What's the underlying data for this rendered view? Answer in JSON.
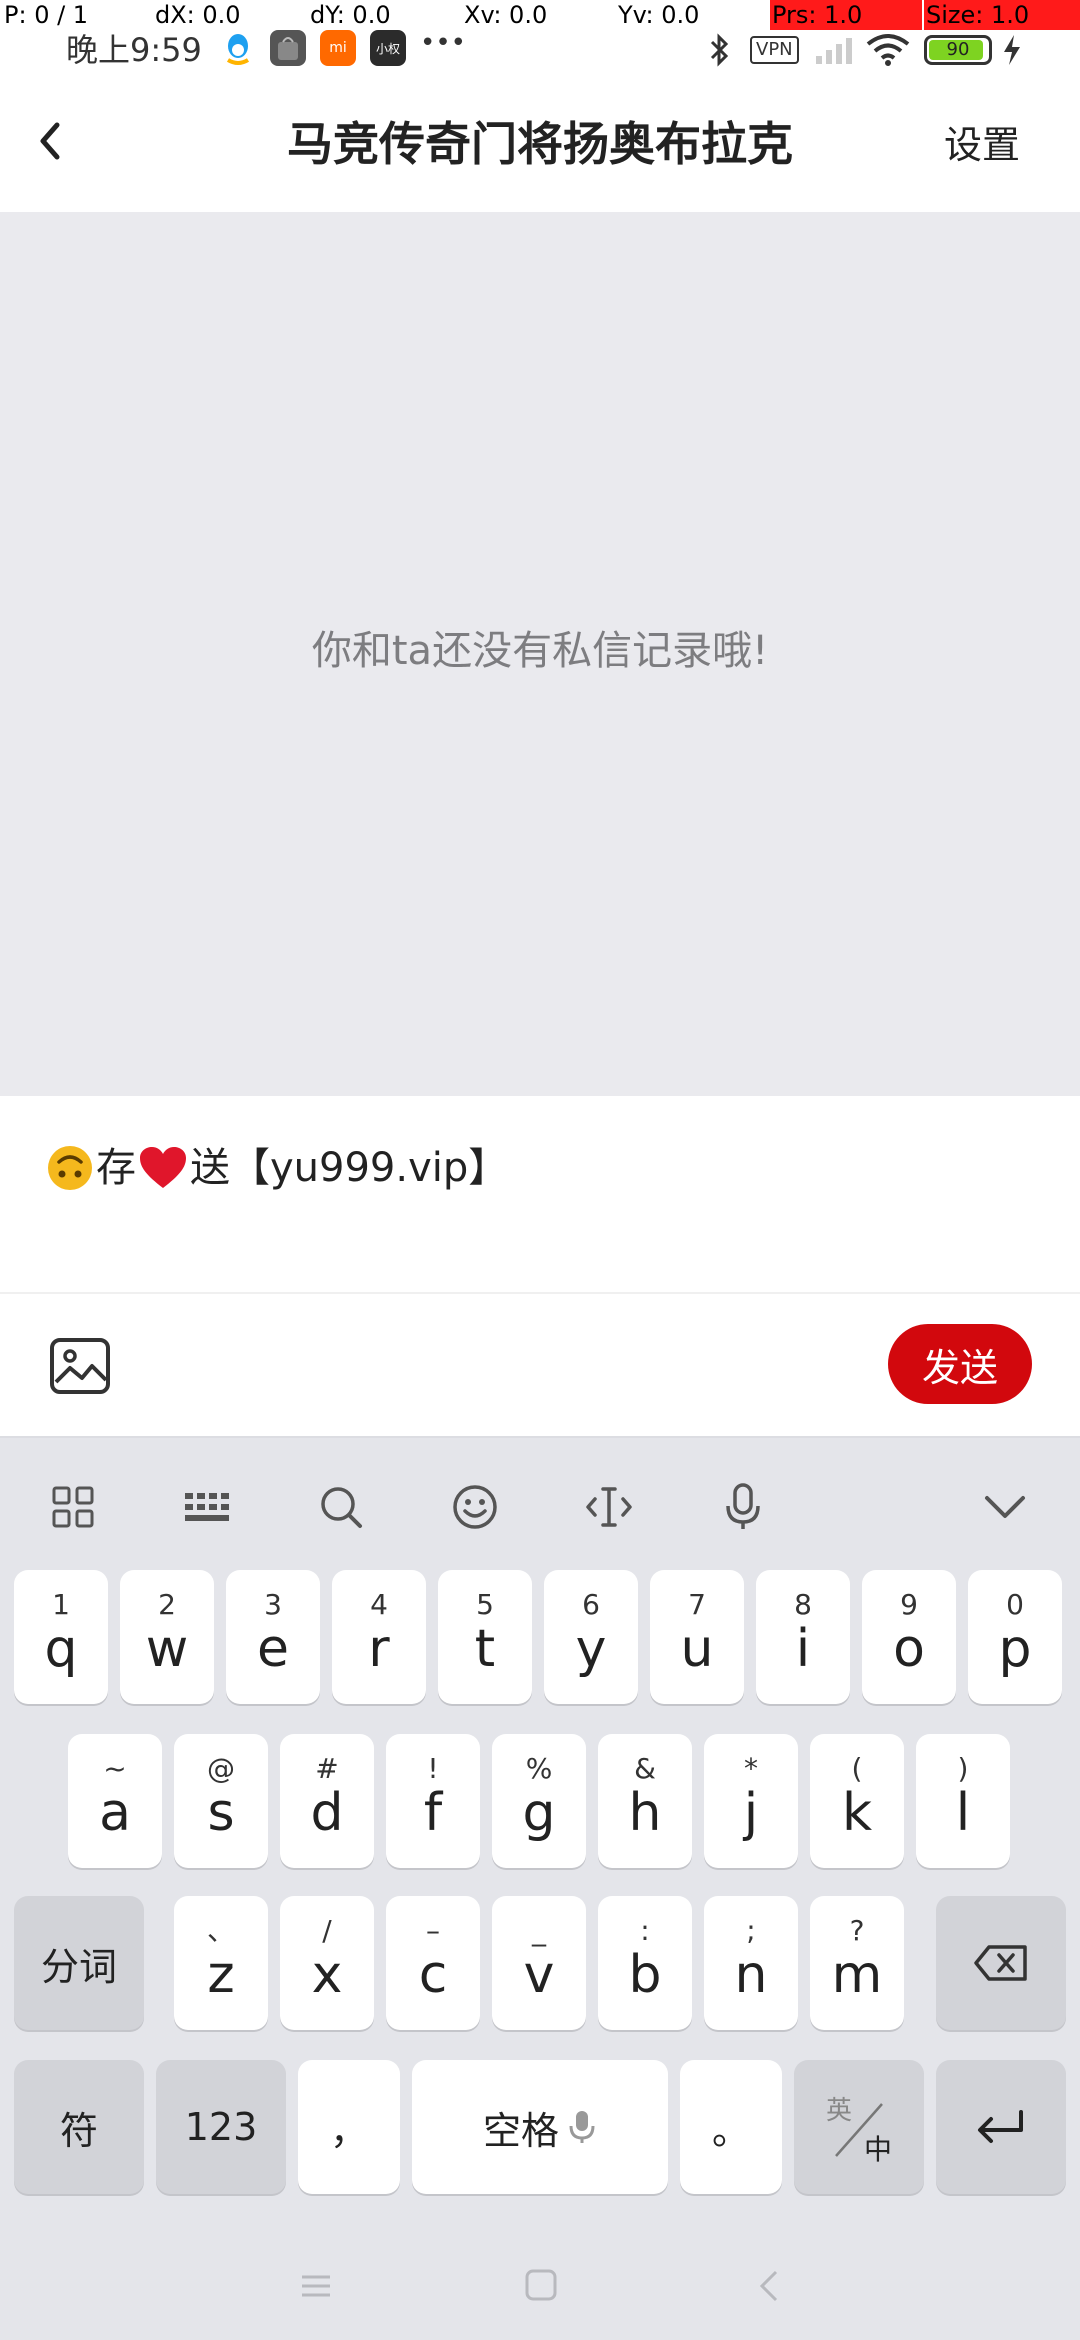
{
  "debug": {
    "p": "P: 0 / 1",
    "dx": "dX: 0.0",
    "dy": "dY: 0.0",
    "xv": "Xv: 0.0",
    "yv": "Yv: 0.0",
    "prs": "Prs: 1.0",
    "size": "Size: 1.0"
  },
  "status": {
    "time": "晚上9:59",
    "more": "•••",
    "vpn": "VPN",
    "battery": "90",
    "app_icon_3_label": "mi",
    "app_icon_4_label": "小权"
  },
  "header": {
    "title": "马竞传奇门将扬奥布拉克",
    "settings": "设置"
  },
  "chat": {
    "empty_message": "你和ta还没有私信记录哦!"
  },
  "input": {
    "value_part1": "存",
    "value_part2": "送【yu999.vip】"
  },
  "toolbar": {
    "send_label": "发送"
  },
  "keyboard": {
    "row1": [
      {
        "main": "q",
        "hint": "1"
      },
      {
        "main": "w",
        "hint": "2"
      },
      {
        "main": "e",
        "hint": "3"
      },
      {
        "main": "r",
        "hint": "4"
      },
      {
        "main": "t",
        "hint": "5"
      },
      {
        "main": "y",
        "hint": "6"
      },
      {
        "main": "u",
        "hint": "7"
      },
      {
        "main": "i",
        "hint": "8"
      },
      {
        "main": "o",
        "hint": "9"
      },
      {
        "main": "p",
        "hint": "0"
      }
    ],
    "row2": [
      {
        "main": "a",
        "hint": "~"
      },
      {
        "main": "s",
        "hint": "@"
      },
      {
        "main": "d",
        "hint": "#"
      },
      {
        "main": "f",
        "hint": "!"
      },
      {
        "main": "g",
        "hint": "%"
      },
      {
        "main": "h",
        "hint": "&"
      },
      {
        "main": "j",
        "hint": "*"
      },
      {
        "main": "k",
        "hint": "("
      },
      {
        "main": "l",
        "hint": ")"
      }
    ],
    "row3": [
      {
        "main": "z",
        "hint": "、"
      },
      {
        "main": "x",
        "hint": "/"
      },
      {
        "main": "c",
        "hint": "–"
      },
      {
        "main": "v",
        "hint": "_"
      },
      {
        "main": "b",
        "hint": ":"
      },
      {
        "main": "n",
        "hint": ";"
      },
      {
        "main": "m",
        "hint": "?"
      }
    ],
    "fenci": "分词",
    "fu": "符",
    "num": "123",
    "comma": "，",
    "space": "空格",
    "period": "。",
    "lang_top": "英",
    "lang_bottom": "中"
  },
  "colors": {
    "send_button": "#d2080d",
    "chat_background": "#eaeaee",
    "keyboard_background": "#e4e5ea"
  }
}
